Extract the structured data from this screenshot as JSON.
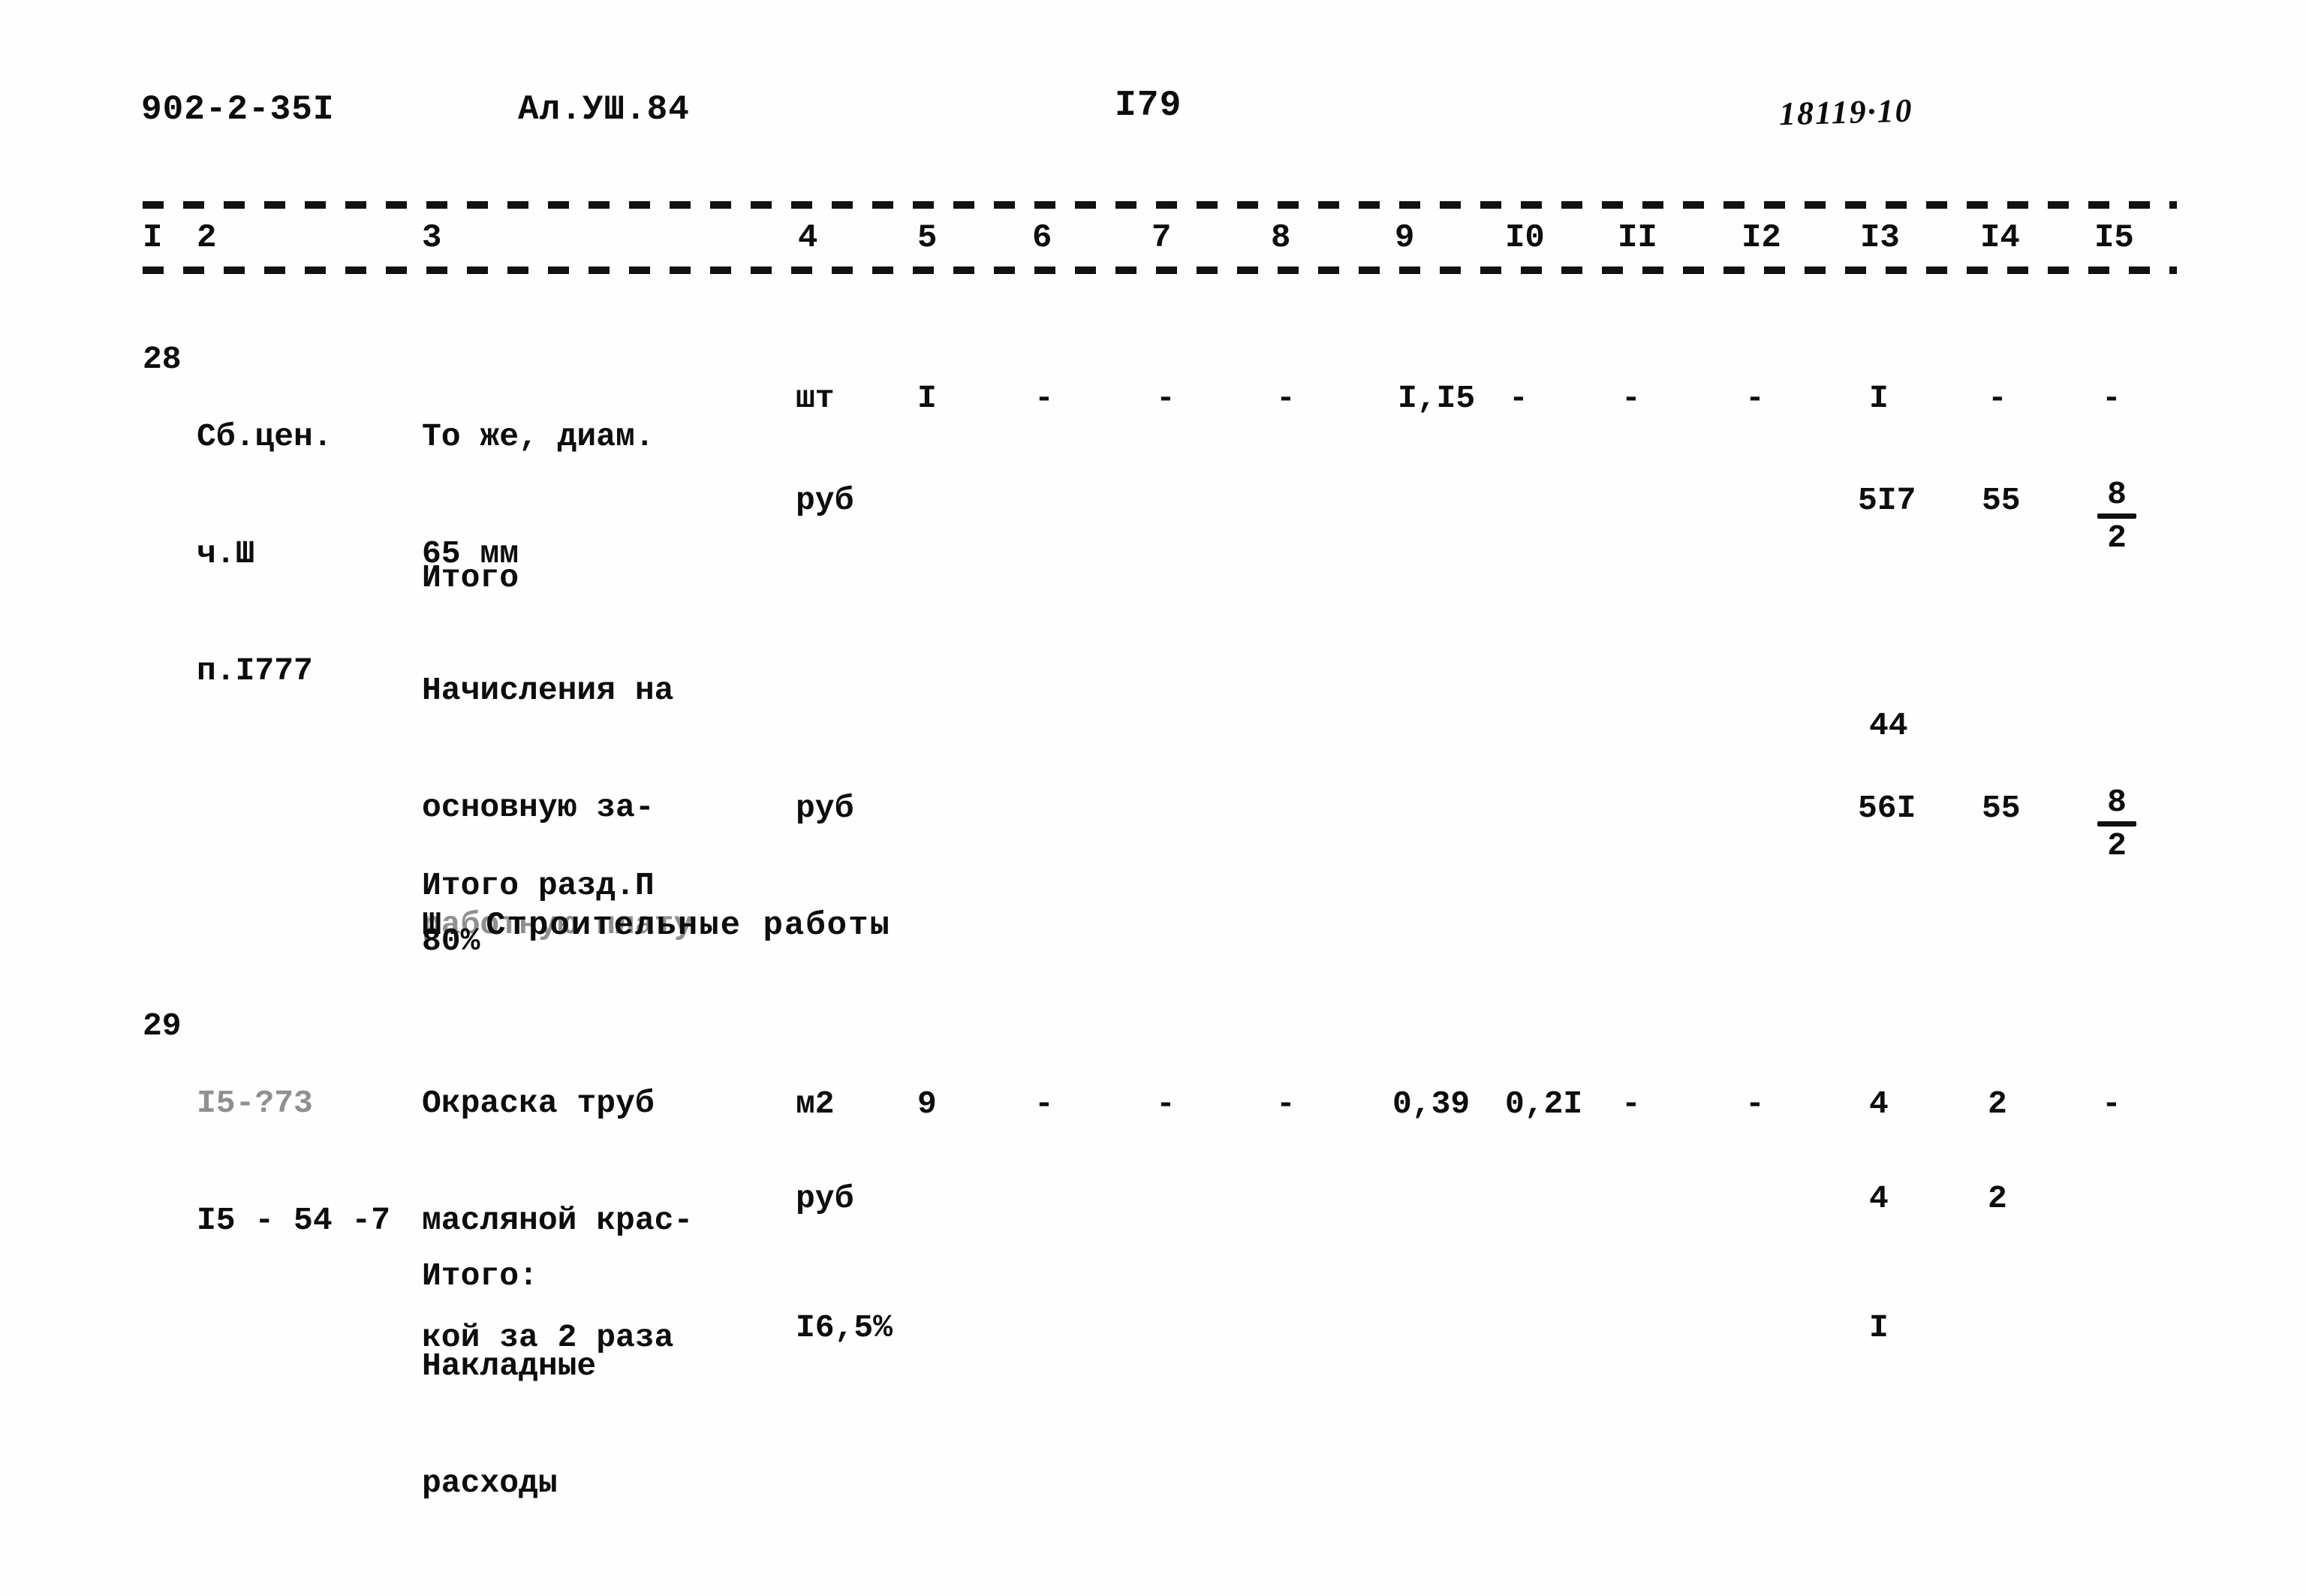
{
  "header": {
    "doc_code": "902-2-35I",
    "album": "Ал.УШ.84",
    "page_number": "I79",
    "stamp": "18119·10"
  },
  "table": {
    "column_numbers": [
      "I",
      "2",
      "3",
      "4",
      "5",
      "6",
      "7",
      "8",
      "9",
      "I0",
      "II",
      "I2",
      "I3",
      "I4",
      "I5"
    ],
    "rows": [
      {
        "no": "28",
        "code_lines": [
          "Сб.цен.",
          "ч.Ш",
          "п.I777"
        ],
        "desc_lines": [
          "То же, диам.",
          "65 мм"
        ],
        "unit": "шт",
        "c5": "I",
        "c6": "-",
        "c7": "-",
        "c8": "-",
        "c9": "I,I5",
        "c10": "-",
        "c11": "-",
        "c12": "-",
        "c13": "I",
        "c14": "-",
        "c15": "-"
      },
      {
        "no": "",
        "desc_lines": [
          "Итого"
        ],
        "unit": "руб",
        "c13": "5I7",
        "c14": "55",
        "c15_frac_num": "8",
        "c15_frac_den": "2"
      },
      {
        "no": "",
        "desc_lines": [
          "Начисления на",
          "основную за-",
          "работную плату",
          "80%"
        ],
        "unit": "",
        "c13": "44"
      },
      {
        "no": "",
        "desc_lines": [
          "Итого разд.П"
        ],
        "unit": "руб",
        "c13": "56I",
        "c14": "55",
        "c15_frac_num": "8",
        "c15_frac_den": "2"
      },
      {
        "no": "29",
        "code_lines": [
          "I5-?73",
          "I5 - 54 -7"
        ],
        "desc_lines": [
          "Окраска труб",
          "масляной крас-",
          "кой за 2 раза"
        ],
        "unit": "м2",
        "c5": "9",
        "c6": "-",
        "c7": "-",
        "c8": "-",
        "c9": "0,39",
        "c10": "0,2I",
        "c11": "-",
        "c12": "-",
        "c13": "4",
        "c14": "2",
        "c15": "-"
      },
      {
        "no": "",
        "desc_lines": [
          "Итого:"
        ],
        "unit": "руб",
        "c13": "4",
        "c14": "2"
      },
      {
        "no": "",
        "desc_lines": [
          "Накладные",
          "расходы"
        ],
        "unit": "I6,5%",
        "c13": "I"
      }
    ],
    "section_heading": "Ш. Строительные работы"
  }
}
